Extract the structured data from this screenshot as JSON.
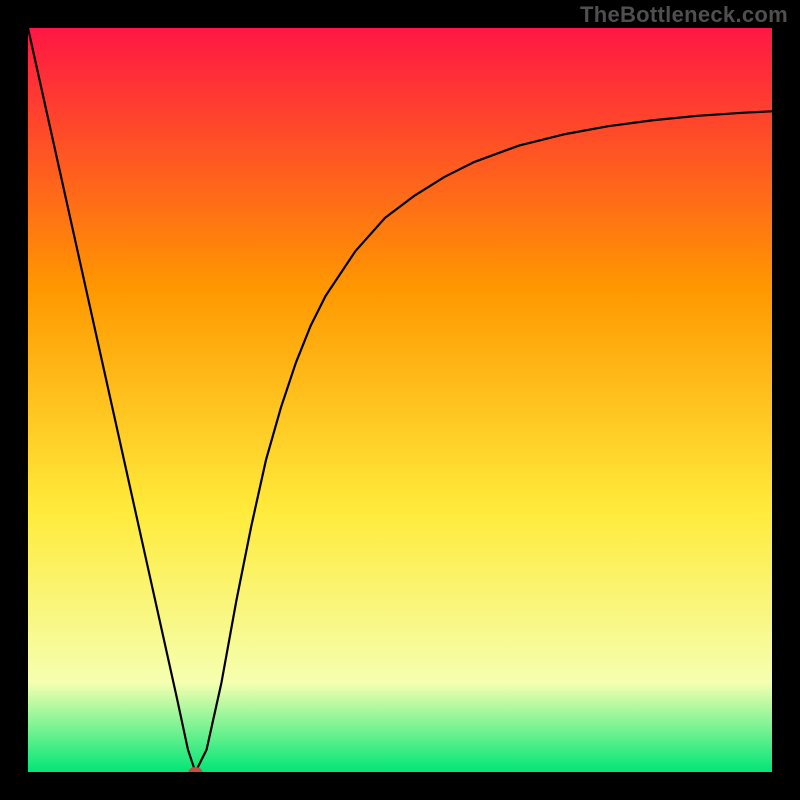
{
  "watermark": "TheBottleneck.com",
  "chart_data": {
    "type": "line",
    "title": "",
    "xlabel": "",
    "ylabel": "",
    "xlim": [
      0,
      100
    ],
    "ylim": [
      0,
      100
    ],
    "grid": false,
    "legend": false,
    "background_gradient": {
      "top": "#ff1744",
      "mid1": "#ff9800",
      "mid2": "#ffeb3b",
      "mid3": "#f5ffb0",
      "bottom": "#00e676"
    },
    "series": [
      {
        "name": "bottleneck-curve",
        "color": "#000000",
        "x": [
          0,
          2,
          4,
          6,
          8,
          10,
          12,
          14,
          16,
          18,
          20,
          21.5,
          22.5,
          24,
          26,
          28,
          30,
          32,
          34,
          36,
          38,
          40,
          44,
          48,
          52,
          56,
          60,
          66,
          72,
          78,
          84,
          90,
          96,
          100
        ],
        "y": [
          100,
          91,
          82,
          73,
          64,
          55,
          46,
          37,
          28,
          19,
          10,
          3,
          0,
          3,
          12,
          23,
          33,
          42,
          49,
          55,
          60,
          64,
          70,
          74.5,
          77.5,
          80,
          82,
          84.2,
          85.7,
          86.8,
          87.6,
          88.2,
          88.6,
          88.8
        ]
      }
    ],
    "marker": {
      "name": "optimal-point",
      "x": 22.5,
      "y": 0,
      "color": "#cc4a3e",
      "rx": 7,
      "ry": 5
    }
  }
}
